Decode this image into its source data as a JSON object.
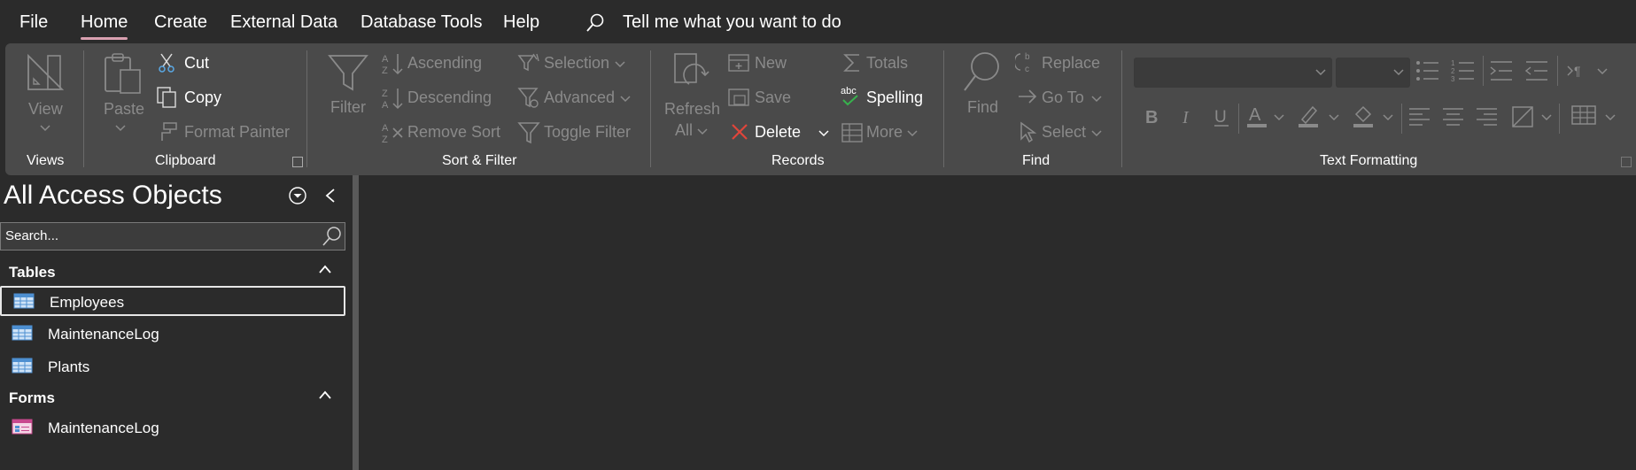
{
  "menu": {
    "file": "File",
    "home": "Home",
    "create": "Create",
    "external_data": "External Data",
    "database_tools": "Database Tools",
    "help": "Help",
    "tell_me": "Tell me what you want to do"
  },
  "ribbon": {
    "views": {
      "view": "View",
      "group": "Views"
    },
    "clipboard": {
      "paste": "Paste",
      "cut": "Cut",
      "copy": "Copy",
      "format_painter": "Format Painter",
      "group": "Clipboard"
    },
    "sort_filter": {
      "filter": "Filter",
      "ascending": "Ascending",
      "descending": "Descending",
      "remove_sort": "Remove Sort",
      "selection": "Selection",
      "advanced": "Advanced",
      "toggle_filter": "Toggle Filter",
      "group": "Sort & Filter"
    },
    "records": {
      "refresh": "Refresh",
      "refresh_all": "All",
      "new": "New",
      "save": "Save",
      "delete": "Delete",
      "totals": "Totals",
      "spelling": "Spelling",
      "more": "More",
      "group": "Records"
    },
    "find": {
      "find": "Find",
      "replace": "Replace",
      "go_to": "Go To",
      "select": "Select",
      "group": "Find"
    },
    "text_formatting": {
      "group": "Text Formatting",
      "font_name": "",
      "font_size": ""
    }
  },
  "nav": {
    "title": "All Access Objects",
    "search_placeholder": "Search...",
    "categories": [
      {
        "label": "Tables",
        "items": [
          "Employees",
          "MaintenanceLog",
          "Plants"
        ]
      },
      {
        "label": "Forms",
        "items": [
          "MaintenanceLog"
        ]
      }
    ]
  },
  "colors": {
    "background": "#2b2b2b",
    "ribbon": "#4a4a4a",
    "accent": "#d9a0b0",
    "dim_text": "#8a8a8a"
  }
}
